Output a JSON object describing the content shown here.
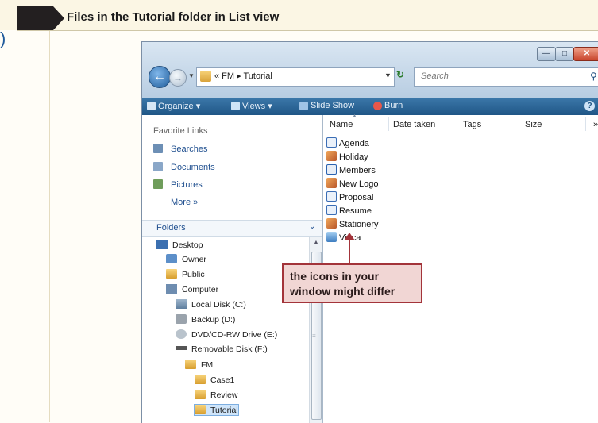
{
  "caption": "Files in the Tutorial folder in List view",
  "page_mark": ")",
  "window": {
    "controls": {
      "minimize": "—",
      "maximize": "□",
      "close": "✕"
    },
    "address": {
      "text": "« FM ▸ Tutorial"
    },
    "search_placeholder": "Search",
    "toolbar": {
      "organize": "Organize ▾",
      "views": "Views ▾",
      "slideshow": "Slide Show",
      "burn": "Burn"
    },
    "favorite_links": {
      "title": "Favorite Links",
      "items": [
        "Searches",
        "Documents",
        "Pictures"
      ],
      "more": "More »"
    },
    "folders_title": "Folders",
    "tree": [
      {
        "label": "Desktop",
        "icon": "desktop-icon"
      },
      {
        "label": "Owner",
        "icon": "user-folder-icon"
      },
      {
        "label": "Public",
        "icon": "folder-icon"
      },
      {
        "label": "Computer",
        "icon": "computer-icon"
      },
      {
        "label": "Local Disk (C:)",
        "icon": "local-disk-icon"
      },
      {
        "label": "Backup (D:)",
        "icon": "drive-icon"
      },
      {
        "label": "DVD/CD-RW Drive (E:)",
        "icon": "dvd-drive-icon"
      },
      {
        "label": "Removable Disk (F:)",
        "icon": "removable-disk-icon"
      },
      {
        "label": "FM",
        "icon": "folder-icon"
      },
      {
        "label": "Case1",
        "icon": "folder-icon"
      },
      {
        "label": "Review",
        "icon": "folder-icon"
      },
      {
        "label": "Tutorial",
        "icon": "folder-icon",
        "selected": true
      }
    ],
    "columns": [
      "Name",
      "Date taken",
      "Tags",
      "Size",
      "»"
    ],
    "files": [
      {
        "name": "Agenda",
        "type": "word"
      },
      {
        "name": "Holiday",
        "type": "photo"
      },
      {
        "name": "Members",
        "type": "html"
      },
      {
        "name": "New Logo",
        "type": "photo"
      },
      {
        "name": "Proposal",
        "type": "word"
      },
      {
        "name": "Resume",
        "type": "word"
      },
      {
        "name": "Stationery",
        "type": "photo"
      },
      {
        "name": "Vinca",
        "type": "image"
      }
    ]
  },
  "callout": {
    "line1": "the icons in your",
    "line2": "window might differ"
  },
  "colors": {
    "callout_border": "#a3343a",
    "callout_fill": "#f1d6d4",
    "command_bar": "#2a6496"
  }
}
